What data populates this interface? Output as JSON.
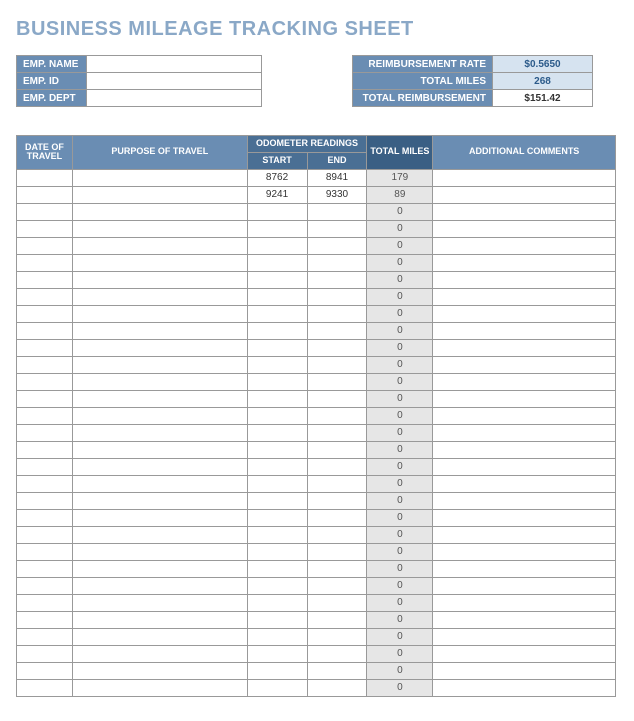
{
  "title": "BUSINESS MILEAGE TRACKING SHEET",
  "emp": {
    "name_label": "EMP. NAME",
    "name_value": "",
    "id_label": "EMP. ID",
    "id_value": "",
    "dept_label": "EMP. DEPT",
    "dept_value": ""
  },
  "summary": {
    "rate_label": "REIMBURSEMENT RATE",
    "rate_value": "$0.5650",
    "miles_label": "TOTAL MILES",
    "miles_value": "268",
    "total_label": "TOTAL REIMBURSEMENT",
    "total_value": "$151.42"
  },
  "headers": {
    "date": "DATE OF TRAVEL",
    "purpose": "PURPOSE OF TRAVEL",
    "odo_group": "ODOMETER READINGS",
    "odo_start": "START",
    "odo_end": "END",
    "total_miles": "TOTAL MILES",
    "comments": "ADDITIONAL COMMENTS"
  },
  "rows": [
    {
      "date": "",
      "purpose": "",
      "start": "8762",
      "end": "8941",
      "miles": "179",
      "comments": ""
    },
    {
      "date": "",
      "purpose": "",
      "start": "9241",
      "end": "9330",
      "miles": "89",
      "comments": ""
    },
    {
      "date": "",
      "purpose": "",
      "start": "",
      "end": "",
      "miles": "0",
      "comments": ""
    },
    {
      "date": "",
      "purpose": "",
      "start": "",
      "end": "",
      "miles": "0",
      "comments": ""
    },
    {
      "date": "",
      "purpose": "",
      "start": "",
      "end": "",
      "miles": "0",
      "comments": ""
    },
    {
      "date": "",
      "purpose": "",
      "start": "",
      "end": "",
      "miles": "0",
      "comments": ""
    },
    {
      "date": "",
      "purpose": "",
      "start": "",
      "end": "",
      "miles": "0",
      "comments": ""
    },
    {
      "date": "",
      "purpose": "",
      "start": "",
      "end": "",
      "miles": "0",
      "comments": ""
    },
    {
      "date": "",
      "purpose": "",
      "start": "",
      "end": "",
      "miles": "0",
      "comments": ""
    },
    {
      "date": "",
      "purpose": "",
      "start": "",
      "end": "",
      "miles": "0",
      "comments": ""
    },
    {
      "date": "",
      "purpose": "",
      "start": "",
      "end": "",
      "miles": "0",
      "comments": ""
    },
    {
      "date": "",
      "purpose": "",
      "start": "",
      "end": "",
      "miles": "0",
      "comments": ""
    },
    {
      "date": "",
      "purpose": "",
      "start": "",
      "end": "",
      "miles": "0",
      "comments": ""
    },
    {
      "date": "",
      "purpose": "",
      "start": "",
      "end": "",
      "miles": "0",
      "comments": ""
    },
    {
      "date": "",
      "purpose": "",
      "start": "",
      "end": "",
      "miles": "0",
      "comments": ""
    },
    {
      "date": "",
      "purpose": "",
      "start": "",
      "end": "",
      "miles": "0",
      "comments": ""
    },
    {
      "date": "",
      "purpose": "",
      "start": "",
      "end": "",
      "miles": "0",
      "comments": ""
    },
    {
      "date": "",
      "purpose": "",
      "start": "",
      "end": "",
      "miles": "0",
      "comments": ""
    },
    {
      "date": "",
      "purpose": "",
      "start": "",
      "end": "",
      "miles": "0",
      "comments": ""
    },
    {
      "date": "",
      "purpose": "",
      "start": "",
      "end": "",
      "miles": "0",
      "comments": ""
    },
    {
      "date": "",
      "purpose": "",
      "start": "",
      "end": "",
      "miles": "0",
      "comments": ""
    },
    {
      "date": "",
      "purpose": "",
      "start": "",
      "end": "",
      "miles": "0",
      "comments": ""
    },
    {
      "date": "",
      "purpose": "",
      "start": "",
      "end": "",
      "miles": "0",
      "comments": ""
    },
    {
      "date": "",
      "purpose": "",
      "start": "",
      "end": "",
      "miles": "0",
      "comments": ""
    },
    {
      "date": "",
      "purpose": "",
      "start": "",
      "end": "",
      "miles": "0",
      "comments": ""
    },
    {
      "date": "",
      "purpose": "",
      "start": "",
      "end": "",
      "miles": "0",
      "comments": ""
    },
    {
      "date": "",
      "purpose": "",
      "start": "",
      "end": "",
      "miles": "0",
      "comments": ""
    },
    {
      "date": "",
      "purpose": "",
      "start": "",
      "end": "",
      "miles": "0",
      "comments": ""
    },
    {
      "date": "",
      "purpose": "",
      "start": "",
      "end": "",
      "miles": "0",
      "comments": ""
    },
    {
      "date": "",
      "purpose": "",
      "start": "",
      "end": "",
      "miles": "0",
      "comments": ""
    },
    {
      "date": "",
      "purpose": "",
      "start": "",
      "end": "",
      "miles": "0",
      "comments": ""
    }
  ]
}
